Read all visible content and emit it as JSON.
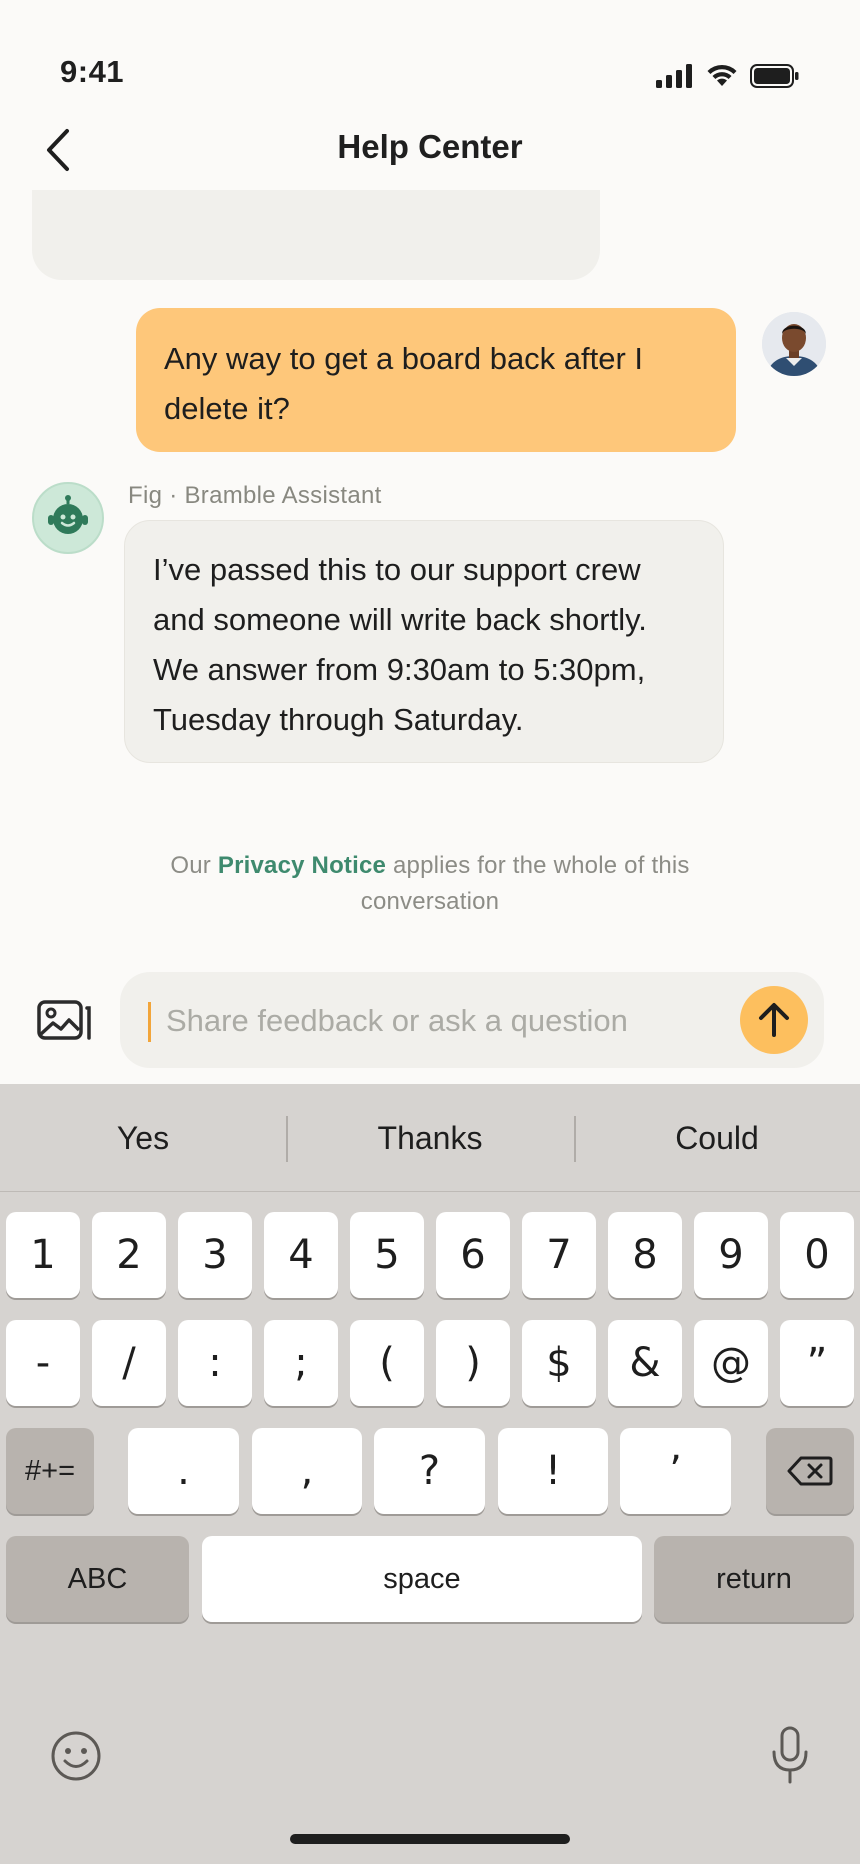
{
  "status_bar": {
    "time": "9:41",
    "icons": [
      "signal-icon",
      "wifi-icon",
      "battery-icon"
    ]
  },
  "header": {
    "title": "Help Center",
    "back_icon": "chevron-left-icon"
  },
  "messages": {
    "user": {
      "text": "Any way to get a board back after I delete it?",
      "avatar": "user-avatar"
    },
    "bot": {
      "sender": "Fig · Bramble Assistant",
      "text": "I’ve passed this to our support crew and someone will write back shortly. We answer from 9:30am to 5:30pm, Tuesday through Saturday."
    }
  },
  "privacy": {
    "prefix": "Our",
    "link": "Privacy Notice",
    "suffix": "applies for the whole of this conversation"
  },
  "composer": {
    "placeholder": "Share feedback or ask a question",
    "value": "",
    "attach_icon": "image-icon",
    "send_icon": "arrow-up-icon"
  },
  "keyboard": {
    "suggestions": [
      "Yes",
      "Thanks",
      "Could"
    ],
    "row1": [
      "1",
      "2",
      "3",
      "4",
      "5",
      "6",
      "7",
      "8",
      "9",
      "0"
    ],
    "row2": [
      "-",
      "/",
      ":",
      ";",
      "(",
      ")",
      "$",
      "&",
      "@",
      "”"
    ],
    "row3_left": "#+=",
    "row3": [
      ".",
      ",",
      "?",
      "!",
      "’"
    ],
    "backspace_icon": "backspace-icon",
    "abc": "ABC",
    "space": "space",
    "return": "return",
    "emoji_icon": "emoji-icon",
    "mic_icon": "microphone-icon"
  },
  "colors": {
    "accent": "#FDBF5E",
    "user_bubble": "#FEC77A",
    "link": "#3E8A6E",
    "bot_bubble": "#F1F0EC"
  }
}
